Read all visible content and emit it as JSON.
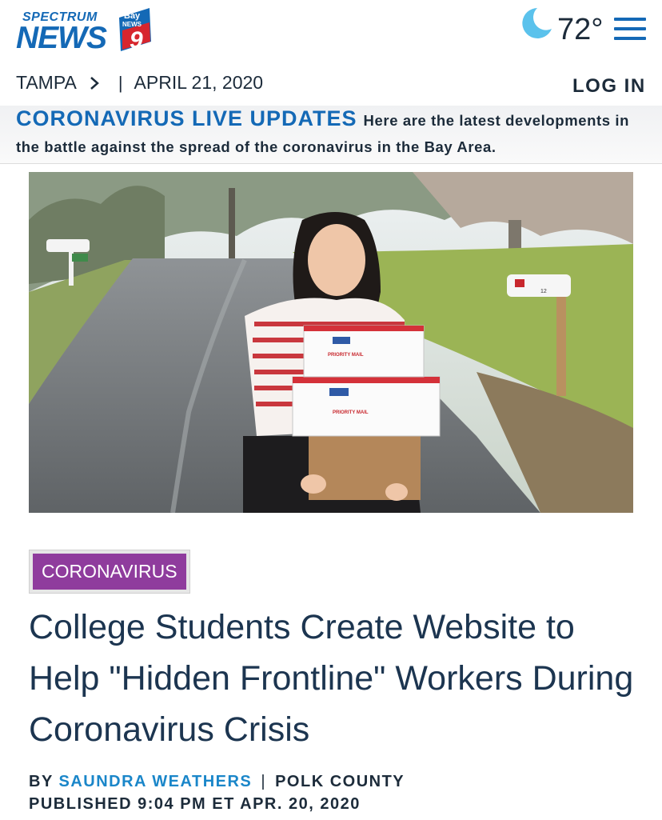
{
  "header": {
    "logo": {
      "top": "SPECTRUM",
      "main": "NEWS",
      "badge_top": "Bay",
      "badge_mid": "NEWS",
      "badge_num": "9"
    },
    "weather": {
      "temperature": "72°",
      "icon": "moon-icon"
    },
    "menu_icon": "hamburger-icon",
    "location": "TAMPA",
    "date": "APRIL 21, 2020",
    "separator": "|",
    "login_label": "LOG IN"
  },
  "banner": {
    "title": "CORONAVIRUS LIVE UPDATES",
    "text": "Here are the latest developments in the battle against the spread of the coronavirus in the Bay Area."
  },
  "article": {
    "hero_image_alt": "Student holding Priority Mail boxes beside mailboxes on a road",
    "box_label": "PRIORITY MAIL",
    "mailbox_number": "12",
    "category": "CORONAVIRUS",
    "headline": "College Students Create Website to Help \"Hidden Frontline\" Workers During Coronavirus Crisis",
    "byline_prefix": "BY",
    "author": "SAUNDRA WEATHERS",
    "byline_sep": "|",
    "region": "POLK COUNTY",
    "published": "PUBLISHED 9:04 PM ET APR. 20, 2020"
  },
  "colors": {
    "brand_blue": "#1469b6",
    "category_purple": "#8f3c9d",
    "link_blue": "#1a86c9",
    "text_dark": "#1c2b3a"
  }
}
